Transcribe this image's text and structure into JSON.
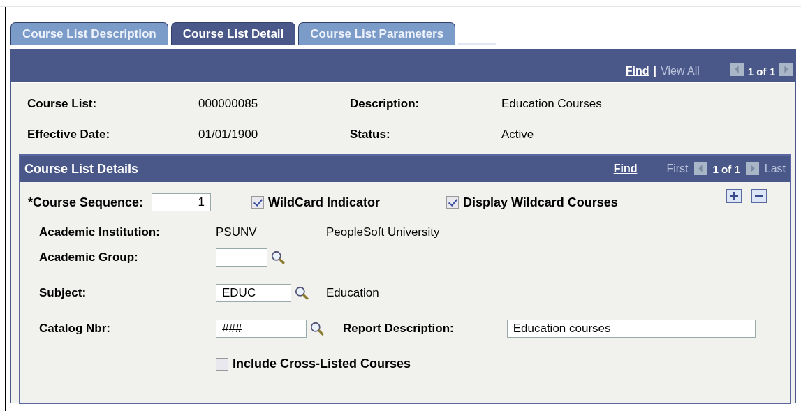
{
  "tabs": [
    {
      "label": "Course List Description",
      "selected": false
    },
    {
      "label": "Course List Detail",
      "selected": true
    },
    {
      "label": "Course List Parameters",
      "selected": false
    }
  ],
  "header_nav": {
    "find": "Find",
    "separator": "|",
    "view_all": "View All",
    "count": "1 of 1"
  },
  "summary": [
    {
      "label": "Course List:",
      "value": "000000085"
    },
    {
      "label": "Description:",
      "value": "Education Courses"
    },
    {
      "label": "Effective Date:",
      "value": "01/01/1900"
    },
    {
      "label": "Status:",
      "value": "Active"
    }
  ],
  "details": {
    "title": "Course List Details",
    "find": "Find",
    "first": "First",
    "count": "1 of 1",
    "last": "Last",
    "course_sequence": {
      "label": "*Course Sequence:",
      "value": "1"
    },
    "wildcard_indicator": {
      "label": "WildCard Indicator",
      "checked": true
    },
    "display_wildcard": {
      "label": "Display Wildcard Courses",
      "checked": true
    },
    "institution": {
      "label": "Academic Institution:",
      "code": "PSUNV",
      "name": "PeopleSoft University"
    },
    "academic_group": {
      "label": "Academic Group:"
    },
    "subject": {
      "label": "Subject:",
      "value": "EDUC",
      "name": "Education"
    },
    "catalog": {
      "label": "Catalog Nbr:",
      "value": "###"
    },
    "report_description": {
      "label": "Report Description:",
      "value": "Education courses"
    },
    "cross_listed": {
      "label": "Include Cross-Listed Courses",
      "checked": false
    }
  }
}
